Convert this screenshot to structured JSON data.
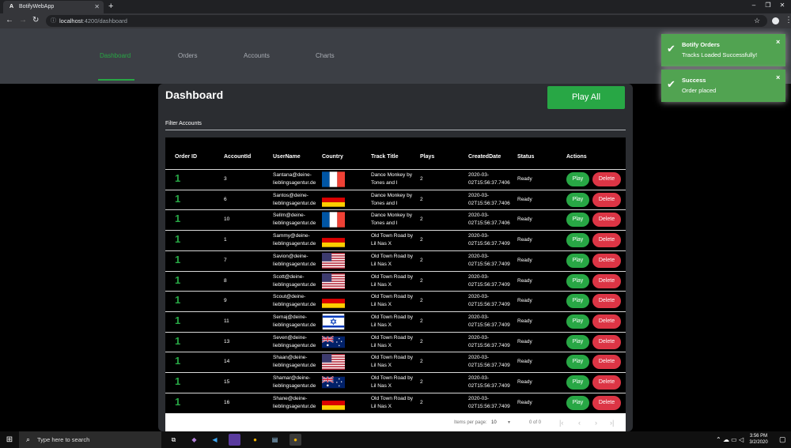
{
  "browser": {
    "tab_title": "BotifyWebApp",
    "tab_favicon": "A",
    "url_host": "localhost",
    "url_path": ":4200/dashboard"
  },
  "nav": {
    "items": [
      {
        "label": "Dashboard",
        "active": true
      },
      {
        "label": "Orders",
        "active": false
      },
      {
        "label": "Accounts",
        "active": false
      },
      {
        "label": "Charts",
        "active": false
      }
    ]
  },
  "dashboard": {
    "title": "Dashboard",
    "play_all_label": "Play All",
    "filter_label": "Filter Accounts"
  },
  "table": {
    "headers": [
      "Order ID",
      "AccountId",
      "UserName",
      "Country",
      "Track Title",
      "Plays",
      "CreatedDate",
      "Status",
      "Actions"
    ],
    "play_label": "Play",
    "delete_label": "Delete",
    "rows": [
      {
        "order_id": "1",
        "account_id": "3",
        "user_line1": "Santana@deine-",
        "user_line2": "lieblingsagentur.de",
        "flag": "fr",
        "track_line1": "Dance Monkey by",
        "track_line2": "Tones and I",
        "plays": "2",
        "date_line1": "2020-03-",
        "date_line2": "02T15:56:37.7406",
        "status": "Ready"
      },
      {
        "order_id": "1",
        "account_id": "6",
        "user_line1": "Santos@deine-",
        "user_line2": "lieblingsagentur.de",
        "flag": "de",
        "track_line1": "Dance Monkey by",
        "track_line2": "Tones and I",
        "plays": "2",
        "date_line1": "2020-03-",
        "date_line2": "02T15:56:37.7406",
        "status": "Ready"
      },
      {
        "order_id": "1",
        "account_id": "10",
        "user_line1": "Sellm@deine-",
        "user_line2": "lieblingsagentur.de",
        "flag": "fr",
        "track_line1": "Dance Monkey by",
        "track_line2": "Tones and I",
        "plays": "2",
        "date_line1": "2020-03-",
        "date_line2": "02T15:56:37.7406",
        "status": "Ready"
      },
      {
        "order_id": "1",
        "account_id": "1",
        "user_line1": "Sammy@deine-",
        "user_line2": "lieblingsagentur.de",
        "flag": "de",
        "track_line1": "Old Town Road by",
        "track_line2": "Lil Nas X",
        "plays": "2",
        "date_line1": "2020-03-",
        "date_line2": "02T15:56:37.7409",
        "status": "Ready"
      },
      {
        "order_id": "1",
        "account_id": "7",
        "user_line1": "Savion@deine-",
        "user_line2": "lieblingsagentur.de",
        "flag": "us",
        "track_line1": "Old Town Road by",
        "track_line2": "Lil Nas X",
        "plays": "2",
        "date_line1": "2020-03-",
        "date_line2": "02T15:56:37.7409",
        "status": "Ready"
      },
      {
        "order_id": "1",
        "account_id": "8",
        "user_line1": "Scott@deine-",
        "user_line2": "lieblingsagentur.de",
        "flag": "us",
        "track_line1": "Old Town Road by",
        "track_line2": "Lil Nas X",
        "plays": "2",
        "date_line1": "2020-03-",
        "date_line2": "02T15:56:37.7409",
        "status": "Ready"
      },
      {
        "order_id": "1",
        "account_id": "9",
        "user_line1": "Scout@deine-",
        "user_line2": "lieblingsagentur.de",
        "flag": "de",
        "track_line1": "Old Town Road by",
        "track_line2": "Lil Nas X",
        "plays": "2",
        "date_line1": "2020-03-",
        "date_line2": "02T15:56:37.7409",
        "status": "Ready"
      },
      {
        "order_id": "1",
        "account_id": "11",
        "user_line1": "Semaj@deine-",
        "user_line2": "lieblingsagentur.de",
        "flag": "il",
        "track_line1": "Old Town Road by",
        "track_line2": "Lil Nas X",
        "plays": "2",
        "date_line1": "2020-03-",
        "date_line2": "02T15:56:37.7409",
        "status": "Ready"
      },
      {
        "order_id": "1",
        "account_id": "13",
        "user_line1": "Seven@deine-",
        "user_line2": "lieblingsagentur.de",
        "flag": "au",
        "track_line1": "Old Town Road by",
        "track_line2": "Lil Nas X",
        "plays": "2",
        "date_line1": "2020-03-",
        "date_line2": "02T15:56:37.7409",
        "status": "Ready"
      },
      {
        "order_id": "1",
        "account_id": "14",
        "user_line1": "Shaan@deine-",
        "user_line2": "lieblingsagentur.de",
        "flag": "us",
        "track_line1": "Old Town Road by",
        "track_line2": "Lil Nas X",
        "plays": "2",
        "date_line1": "2020-03-",
        "date_line2": "02T15:56:37.7409",
        "status": "Ready"
      },
      {
        "order_id": "1",
        "account_id": "15",
        "user_line1": "Shamar@deine-",
        "user_line2": "lieblingsagentur.de",
        "flag": "au",
        "track_line1": "Old Town Road by",
        "track_line2": "Lil Nas X",
        "plays": "2",
        "date_line1": "2020-03-",
        "date_line2": "02T15:56:37.7409",
        "status": "Ready"
      },
      {
        "order_id": "1",
        "account_id": "16",
        "user_line1": "Shane@deine-",
        "user_line2": "lieblingsagentur.de",
        "flag": "de",
        "track_line1": "Old Town Road by",
        "track_line2": "Lil Nas X",
        "plays": "2",
        "date_line1": "2020-03-",
        "date_line2": "02T15:56:37.7409",
        "status": "Ready"
      }
    ]
  },
  "paginator": {
    "items_per_page_label": "Items per page:",
    "page_size": "10",
    "range_label": "0 of 0"
  },
  "toasts": [
    {
      "title": "Botify Orders",
      "message": "Tracks Loaded Successfully!"
    },
    {
      "title": "Success",
      "message": "Order placed"
    }
  ],
  "taskbar": {
    "search_placeholder": "Type here to search",
    "time": "3:56 PM",
    "date": "3/2/2020"
  },
  "colors": {
    "accent_green": "#28a745",
    "danger_red": "#dc3545",
    "toast_green": "#51a351",
    "nav_bg": "#3c3f45"
  }
}
